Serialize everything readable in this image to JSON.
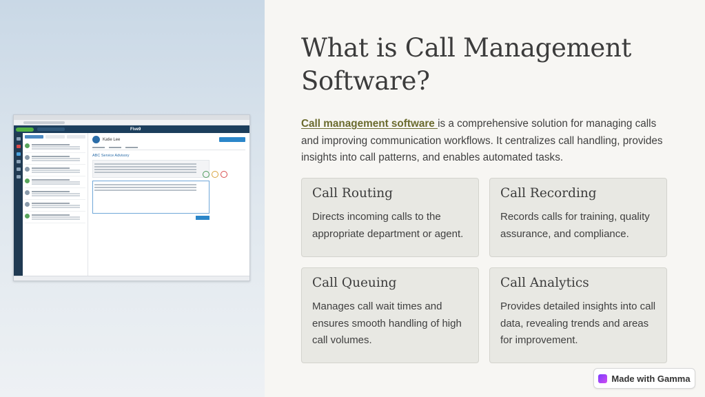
{
  "slide": {
    "title": "What is Call Management Software?",
    "intro_link": "Call management software ",
    "intro_text": "is a comprehensive solution for managing calls and improving communication workflows. It centralizes call handling, provides insights into call patterns, and enables automated tasks."
  },
  "cards": [
    {
      "title": "Call Routing",
      "desc": "Directs incoming calls to the appropriate department or agent."
    },
    {
      "title": "Call Recording",
      "desc": "Records calls for training, quality assurance, and compliance."
    },
    {
      "title": "Call Queuing",
      "desc": "Manages call wait times and ensures smooth handling of high call volumes."
    },
    {
      "title": "Call Analytics",
      "desc": "Provides detailed insights into call data, revealing trends and areas for improvement."
    }
  ],
  "screenshot": {
    "brand": "Five9",
    "contact_name": "Katie Lee",
    "subject": "ABC Service Advisory"
  },
  "badge": {
    "label": "Made with Gamma",
    "icon": "gamma-logo-icon"
  },
  "colors": {
    "link": "#6b6b2e",
    "card_bg": "#e8e8e3",
    "app_bar": "#1c3e5c"
  }
}
